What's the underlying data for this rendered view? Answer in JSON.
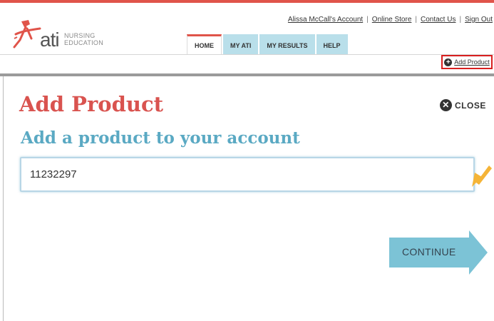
{
  "header": {
    "logo": {
      "brand": "ati",
      "subtitle_line1": "NURSING",
      "subtitle_line2": "EDUCATION"
    },
    "util_links": [
      "Alissa McCall's Account",
      "Online Store",
      "Contact Us",
      "Sign Out"
    ],
    "tabs": [
      {
        "label": "HOME",
        "active": true
      },
      {
        "label": "MY ATI",
        "active": false
      },
      {
        "label": "MY RESULTS",
        "active": false
      },
      {
        "label": "HELP",
        "active": false
      }
    ],
    "add_product_label": "Add Product"
  },
  "modal": {
    "title": "Add Product",
    "close_label": "CLOSE",
    "subtitle": "Add a product to your account",
    "product_code_value": "11232297",
    "continue_label": "CONTINUE"
  },
  "colors": {
    "brand_red": "#e0544a",
    "title_red": "#d9534f",
    "subtitle_blue": "#5aa9c3",
    "tab_blue": "#b9dfea",
    "continue_blue": "#7cc3d6",
    "highlight_red": "#d81f1f",
    "pointer_orange": "#f5b437"
  }
}
